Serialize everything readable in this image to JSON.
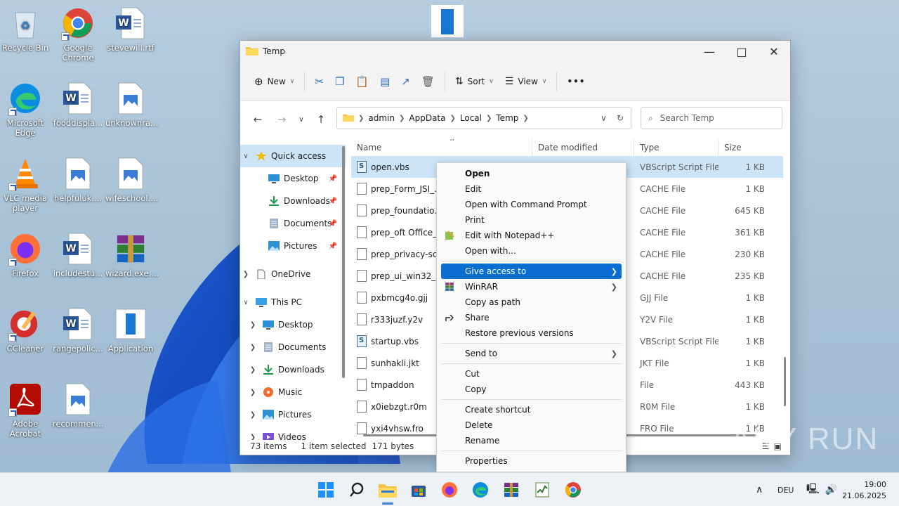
{
  "desktop": {
    "icons": [
      {
        "label": "Recycle Bin",
        "icon": "recycle-bin-icon"
      },
      {
        "label": "Google Chrome",
        "icon": "chrome-icon"
      },
      {
        "label": "stevewill.rtf",
        "icon": "word-doc-icon"
      },
      {
        "label": "Microsoft Edge",
        "icon": "edge-icon"
      },
      {
        "label": "fooddispla...",
        "icon": "word-doc-icon"
      },
      {
        "label": "unknownra...",
        "icon": "image-file-icon"
      },
      {
        "label": "VLC media player",
        "icon": "vlc-icon"
      },
      {
        "label": "helpfuluk....",
        "icon": "image-file-icon"
      },
      {
        "label": "wifeschool....",
        "icon": "image-file-icon"
      },
      {
        "label": "Firefox",
        "icon": "firefox-icon"
      },
      {
        "label": "includestu...",
        "icon": "word-doc-icon"
      },
      {
        "label": "wizard.exe....",
        "icon": "winrar-icon"
      },
      {
        "label": "CCleaner",
        "icon": "ccleaner-icon"
      },
      {
        "label": "rangepolic...",
        "icon": "word-doc-icon"
      },
      {
        "label": "Application",
        "icon": "application-icon"
      },
      {
        "label": "Adobe Acrobat",
        "icon": "acrobat-icon"
      },
      {
        "label": "recommen...",
        "icon": "image-file-icon"
      }
    ]
  },
  "window": {
    "title": "Temp",
    "toolbar": {
      "new_label": "New",
      "sort_label": "Sort",
      "view_label": "View",
      "more_label": "•••"
    },
    "breadcrumb": [
      "admin",
      "AppData",
      "Local",
      "Temp"
    ],
    "search_placeholder": "Search Temp",
    "sidebar": {
      "quick_access": "Quick access",
      "qa_items": [
        "Desktop",
        "Downloads",
        "Documents",
        "Pictures"
      ],
      "onedrive": "OneDrive",
      "this_pc": "This PC",
      "pc_items": [
        "Desktop",
        "Documents",
        "Downloads",
        "Music",
        "Pictures",
        "Videos"
      ]
    },
    "columns": {
      "name": "Name",
      "date": "Date modified",
      "type": "Type",
      "size": "Size"
    },
    "files": [
      {
        "name": "open.vbs",
        "type": "VBScript Script File",
        "size": "1 KB",
        "kind": "vbs"
      },
      {
        "name": "prep_Form_JSI_...",
        "type": "CACHE File",
        "size": "1 KB",
        "kind": "file"
      },
      {
        "name": "prep_foundatio...",
        "type": "CACHE File",
        "size": "645 KB",
        "kind": "file"
      },
      {
        "name": "prep_oft Office_...",
        "type": "CACHE File",
        "size": "361 KB",
        "kind": "file"
      },
      {
        "name": "prep_privacy-sc...",
        "type": "CACHE File",
        "size": "230 KB",
        "kind": "file"
      },
      {
        "name": "prep_ui_win32_l...",
        "type": "CACHE File",
        "size": "235 KB",
        "kind": "file"
      },
      {
        "name": "pxbmcg4o.gjj",
        "type": "GJJ File",
        "size": "1 KB",
        "kind": "file"
      },
      {
        "name": "r333juzf.y2v",
        "type": "Y2V File",
        "size": "1 KB",
        "kind": "file"
      },
      {
        "name": "startup.vbs",
        "type": "VBScript Script File",
        "size": "1 KB",
        "kind": "vbs"
      },
      {
        "name": "sunhakli.jkt",
        "type": "JKT File",
        "size": "1 KB",
        "kind": "file"
      },
      {
        "name": "tmpaddon",
        "type": "File",
        "size": "443 KB",
        "kind": "file"
      },
      {
        "name": "x0iebzgt.r0m",
        "type": "R0M File",
        "size": "1 KB",
        "kind": "file"
      },
      {
        "name": "yxi4vhsw.fro",
        "type": "FRO File",
        "size": "1 KB",
        "kind": "file"
      }
    ],
    "status": {
      "items": "73 items",
      "selected": "1 item selected",
      "bytes": "171 bytes"
    }
  },
  "context_menu": {
    "items": [
      {
        "label": "Open",
        "bold": true
      },
      {
        "label": "Edit"
      },
      {
        "label": "Open with Command Prompt"
      },
      {
        "label": "Print"
      },
      {
        "label": "Edit with Notepad++",
        "icon": "notepadpp-icon"
      },
      {
        "label": "Open with..."
      },
      {
        "sep": true
      },
      {
        "label": "Give access to",
        "submenu": true,
        "highlighted": true
      },
      {
        "label": "WinRAR",
        "submenu": true,
        "icon": "winrar-icon"
      },
      {
        "label": "Copy as path"
      },
      {
        "label": "Share",
        "icon": "share-icon"
      },
      {
        "label": "Restore previous versions"
      },
      {
        "sep": true
      },
      {
        "label": "Send to",
        "submenu": true
      },
      {
        "sep": true
      },
      {
        "label": "Cut"
      },
      {
        "label": "Copy"
      },
      {
        "sep": true
      },
      {
        "label": "Create shortcut"
      },
      {
        "label": "Delete"
      },
      {
        "label": "Rename"
      },
      {
        "sep": true
      },
      {
        "label": "Properties"
      }
    ]
  },
  "taskbar": {
    "language": "DEU",
    "time": "19:00",
    "date": "21.06.2025",
    "apps": [
      "start-icon",
      "search-icon",
      "file-explorer-icon",
      "store-icon",
      "firefox-icon",
      "edge-icon",
      "winrar-icon",
      "taskmgr-icon",
      "chrome-icon"
    ]
  },
  "watermark": "ANY RUN"
}
